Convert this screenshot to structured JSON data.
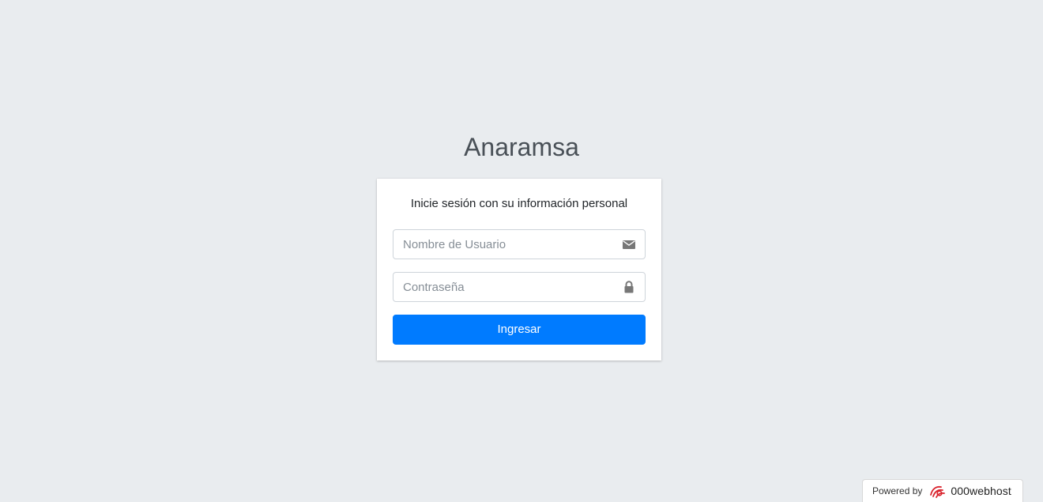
{
  "page": {
    "background_color": "#e9ecef",
    "accent_color": "#007bff"
  },
  "brand": {
    "title": "Anaramsa"
  },
  "login": {
    "message": "Inicie sesión con su información personal",
    "username": {
      "placeholder": "Nombre de Usuario",
      "value": "",
      "icon": "envelope-icon"
    },
    "password": {
      "placeholder": "Contraseña",
      "value": "",
      "icon": "lock-icon"
    },
    "submit_label": "Ingresar"
  },
  "footer_badge": {
    "powered_text": "Powered by",
    "brand_name": "000webhost",
    "icon": "000webhost-logo-icon"
  }
}
